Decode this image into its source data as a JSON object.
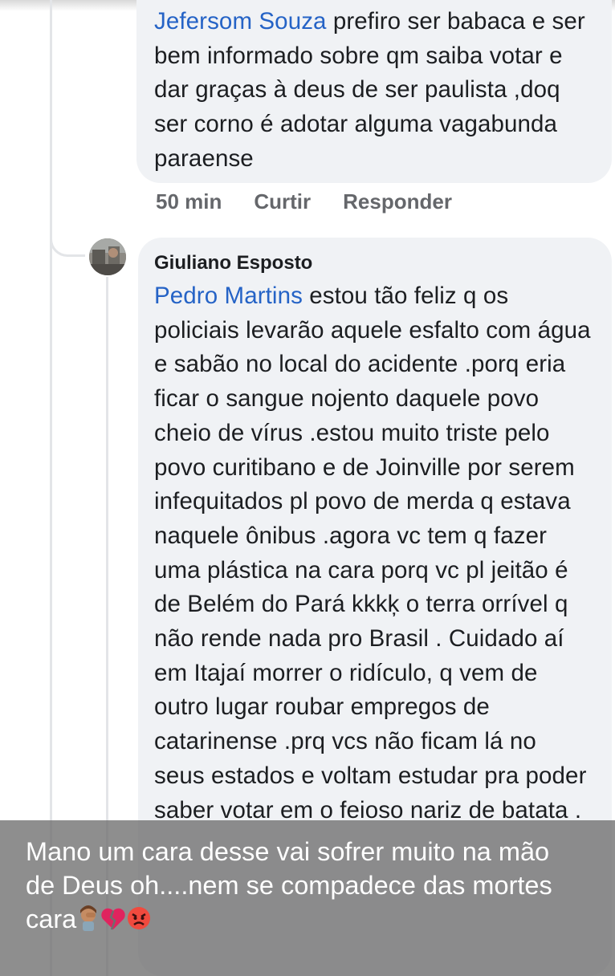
{
  "comment_1": {
    "mention": "Jefersom Souza",
    "body": " prefiro ser babaca e ser bem informado  sobre qm saiba votar e dar graças à deus de ser paulista ,doq  ser corno é adotar alguma vagabunda paraense",
    "time": "50 min",
    "like_label": "Curtir",
    "reply_label": "Responder"
  },
  "comment_2": {
    "author": "Giuliano Esposto",
    "mention": "Pedro Martins",
    "body": "  estou tão feliz  q os policiais  levarão  aquele esfalto com água e sabão  no local do acidente  .porq eria ficar o sangue nojento daquele povo cheio de vírus  .estou muito triste pelo povo curitibano  e de Joinville  por serem infequitados  pl povo de merda q estava naquele ônibus  .agora vc tem q fazer uma plástica na cara porq vc pl jeitão é de Belém do Pará  kkkķ o terra orrível  q não rende nada pro Brasil  . Cuidado aí em Itajaí morrer o ridículo,  q vem de outro lugar roubar empregos  de catarinense    .prq vcs não  ficam lá no seus estados  e voltam estudar pra poder saber votar em o feioso nariz de batata  ."
  },
  "overlay": {
    "caption": "Mano um cara desse vai sofrer muito na mão de Deus oh....nem se compadece das mortes cara",
    "emojis": [
      "facepalm-emoji",
      "broken-heart-emoji",
      "angry-face-emoji"
    ]
  },
  "colors": {
    "mention": "#2563c6",
    "bubble": "#f0f2f5",
    "meta": "#65676b",
    "text": "#1c1e21"
  }
}
